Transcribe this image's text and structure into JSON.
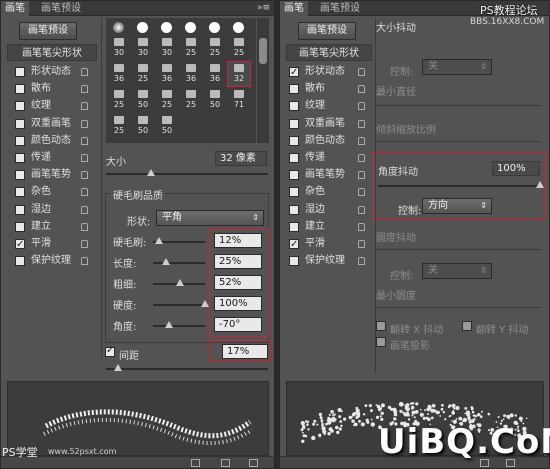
{
  "left": {
    "tabs": [
      {
        "label": "画笔"
      },
      {
        "label": "画笔预设"
      }
    ],
    "preset_button": "画笔预设",
    "sidebar_head": "画笔笔尖形状",
    "sidebar_items": [
      {
        "label": "形状动态",
        "checked": false
      },
      {
        "label": "散布",
        "checked": false
      },
      {
        "label": "纹理",
        "checked": false
      },
      {
        "label": "双重画笔",
        "checked": false
      },
      {
        "label": "颜色动态",
        "checked": false
      },
      {
        "label": "传递",
        "checked": false
      },
      {
        "label": "画笔笔势",
        "checked": false
      },
      {
        "label": "杂色",
        "checked": false
      },
      {
        "label": "湿边",
        "checked": false
      },
      {
        "label": "建立",
        "checked": false
      },
      {
        "label": "平滑",
        "checked": true
      },
      {
        "label": "保护纹理",
        "checked": false
      }
    ],
    "brush_sizes": [
      "30",
      "30",
      "30",
      "25",
      "25",
      "25",
      "36",
      "25",
      "36",
      "36",
      "36",
      "32",
      "25",
      "50",
      "25",
      "25",
      "50",
      "71",
      "25",
      "50",
      "50"
    ],
    "selected_brush_size": "32",
    "size_label": "大小",
    "size_value": "32 像素",
    "bristle_section": "硬毛刷品质",
    "shape_label": "形状:",
    "shape_value": "平角",
    "params": [
      {
        "label": "硬毛刷:",
        "value": "12%",
        "level": 0.12
      },
      {
        "label": "长度:",
        "value": "25%",
        "level": 0.25
      },
      {
        "label": "粗细:",
        "value": "52%",
        "level": 0.52
      },
      {
        "label": "硬度:",
        "value": "100%",
        "level": 1.0
      },
      {
        "label": "角度:",
        "value": "-70°",
        "level": 0.3
      }
    ],
    "spacing_label": "间距",
    "spacing_checked": true,
    "spacing_value": "17%"
  },
  "right": {
    "tabs": [
      {
        "label": "画笔"
      },
      {
        "label": "画笔预设"
      }
    ],
    "preset_button": "画笔预设",
    "sidebar_head": "画笔笔尖形状",
    "sidebar_items": [
      {
        "label": "形状动态",
        "checked": true
      },
      {
        "label": "散布",
        "checked": false
      },
      {
        "label": "纹理",
        "checked": false
      },
      {
        "label": "双重画笔",
        "checked": false
      },
      {
        "label": "颜色动态",
        "checked": false
      },
      {
        "label": "传递",
        "checked": false
      },
      {
        "label": "画笔笔势",
        "checked": false
      },
      {
        "label": "杂色",
        "checked": false
      },
      {
        "label": "湿边",
        "checked": false
      },
      {
        "label": "建立",
        "checked": false
      },
      {
        "label": "平滑",
        "checked": true
      },
      {
        "label": "保护纹理",
        "checked": false
      }
    ],
    "size_jitter": "大小抖动",
    "control_label": "控制:",
    "control_value_off": "关",
    "min_diameter": "最小直径",
    "tilt_scale": "倾斜缩放比例",
    "angle_jitter_label": "角度抖动",
    "angle_jitter_value": "100%",
    "angle_jitter_level": 1.0,
    "angle_control_value": "方向",
    "roundness_jitter": "圆度抖动",
    "roundness_control_value": "关",
    "min_roundness": "最小圆度",
    "flip_x": "翻转 X 抖动",
    "flip_y": "翻转 Y 抖动",
    "brush_projection": "画笔投影"
  },
  "watermarks": {
    "top": "PS教程论坛",
    "top_url": "BBS.16XX8.COM",
    "logo": "UiBQ.CoM",
    "bottom_left": "PS学堂",
    "bottom_url": "www.52psxt.com"
  },
  "colors": {
    "highlight_red": "#c7243a",
    "panel_bg": "#535353"
  }
}
